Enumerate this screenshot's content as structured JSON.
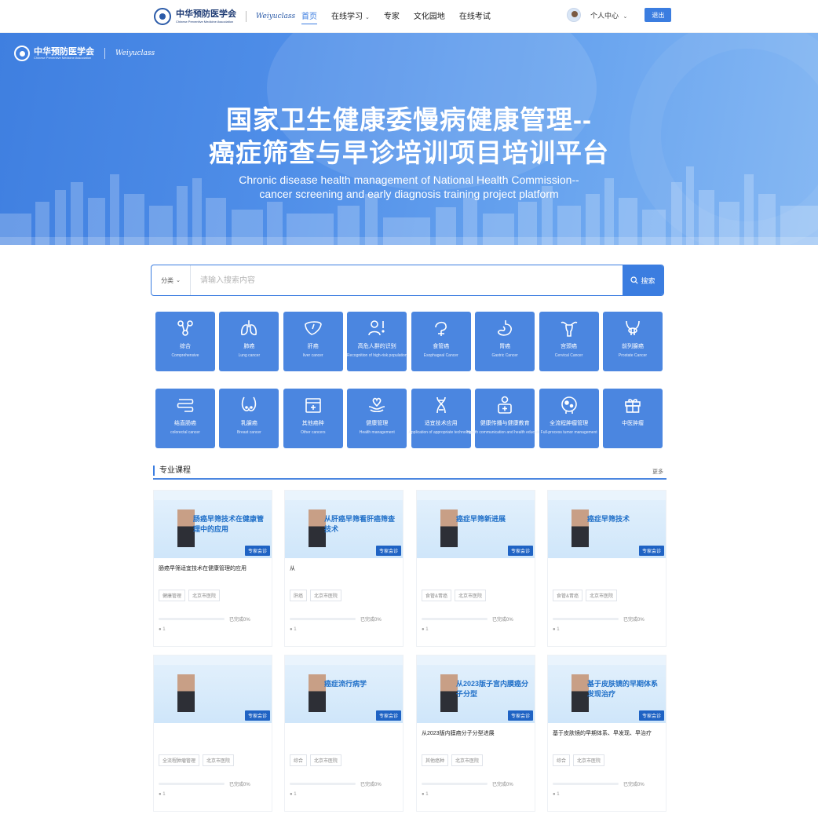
{
  "header": {
    "org_cn": "中华预防医学会",
    "org_en": "Chinese Preventive Medicine Association",
    "partner": "Weiyuclass",
    "nav": [
      {
        "label": "首页",
        "active": true
      },
      {
        "label": "在线学习",
        "dropdown": true
      },
      {
        "label": "专家"
      },
      {
        "label": "文化园地"
      },
      {
        "label": "在线考试"
      }
    ],
    "user_center": "个人中心",
    "logout": "退出"
  },
  "banner": {
    "title_line1": "国家卫生健康委慢病健康管理--",
    "title_line2": "癌症筛查与早诊培训项目培训平台",
    "subtitle_line1": "Chronic disease health management of National Health Commission--",
    "subtitle_line2": "cancer screening and early diagnosis training project platform"
  },
  "search": {
    "category": "分类",
    "placeholder": "请输入搜索内容",
    "button": "搜索"
  },
  "categories_row1": [
    {
      "cn": "综合",
      "en": "Comprehensive",
      "icon": "molecule-icon"
    },
    {
      "cn": "肺癌",
      "en": "Lung cancer",
      "icon": "lung-icon"
    },
    {
      "cn": "肝癌",
      "en": "liver cancer",
      "icon": "liver-icon"
    },
    {
      "cn": "高危人群的识别",
      "en": "Recognition of high-risk population",
      "icon": "alert-person-icon"
    },
    {
      "cn": "食管癌",
      "en": "Esophageal Cancer",
      "icon": "esophagus-icon"
    },
    {
      "cn": "胃癌",
      "en": "Gastric Cancer",
      "icon": "stomach-icon"
    },
    {
      "cn": "宫颈癌",
      "en": "Cervical Cancer",
      "icon": "uterus-icon"
    },
    {
      "cn": "前列腺癌",
      "en": "Prostate Cancer",
      "icon": "prostate-icon"
    }
  ],
  "categories_row2": [
    {
      "cn": "结直肠癌",
      "en": "colorectal cancer",
      "icon": "intestine-icon"
    },
    {
      "cn": "乳腺癌",
      "en": "Breast cancer",
      "icon": "breast-icon"
    },
    {
      "cn": "其他癌种",
      "en": "Other cancers",
      "icon": "medical-kit-icon"
    },
    {
      "cn": "健康管理",
      "en": "Health management",
      "icon": "heart-hand-icon"
    },
    {
      "cn": "适宜技术应用",
      "en": "Application of appropriate technology",
      "icon": "dna-icon"
    },
    {
      "cn": "健康传播与健康教育",
      "en": "Health communication and health education",
      "icon": "person-cross-icon"
    },
    {
      "cn": "全流程肿瘤管理",
      "en": "Full-process tumor management",
      "icon": "cell-icon"
    },
    {
      "cn": "中医肿瘤",
      "en": "",
      "icon": "gift-box-icon"
    }
  ],
  "courses_section": {
    "title": "专业课程",
    "more": "更多"
  },
  "courses": [
    {
      "thumb_text": "肠癌早筛技术在健康管理中的应用",
      "badge": "专家会诊",
      "name": "肠癌早筛适宜技术在健康管理的应用",
      "tags": [
        "健康管理",
        "北京市医院"
      ],
      "progress_label": "已完成0%",
      "progress": 0,
      "views": "1"
    },
    {
      "thumb_text": "从肝癌早筛看肝癌筛查技术",
      "badge": "专家会诊",
      "name": "从",
      "tags": [
        "肝癌",
        "北京市医院"
      ],
      "progress_label": "已完成0%",
      "progress": 0,
      "views": "1"
    },
    {
      "thumb_text": "癌症早筛新进展",
      "badge": "专家会诊",
      "name": "",
      "tags": [
        "食管&胃癌",
        "北京市医院"
      ],
      "progress_label": "已完成0%",
      "progress": 0,
      "views": "1"
    },
    {
      "thumb_text": "癌症早筛技术",
      "badge": "专家会诊",
      "name": "",
      "tags": [
        "食管&胃癌",
        "北京市医院"
      ],
      "progress_label": "已完成0%",
      "progress": 0,
      "views": "1"
    },
    {
      "thumb_text": "",
      "badge": "专家会诊",
      "name": "",
      "tags": [
        "全流程肿瘤管理",
        "北京市医院"
      ],
      "progress_label": "已完成0%",
      "progress": 0,
      "views": "1"
    },
    {
      "thumb_text": "癌症流行病学",
      "badge": "专家会诊",
      "name": "",
      "tags": [
        "综合",
        "北京市医院"
      ],
      "progress_label": "已完成0%",
      "progress": 0,
      "views": "1"
    },
    {
      "thumb_text": "从2023版子宫内膜癌分子分型",
      "badge": "专家会诊",
      "name": "从2023版内膜癌分子分型进展",
      "tags": [
        "其他癌种",
        "北京市医院"
      ],
      "progress_label": "已完成0%",
      "progress": 0,
      "views": "1"
    },
    {
      "thumb_text": "基于皮肤镜的早期体系发现治疗",
      "badge": "专家会诊",
      "name": "基于皮肤镜的早期体系、早发现、早治疗",
      "tags": [
        "综合",
        "北京市医院"
      ],
      "progress_label": "已完成0%",
      "progress": 0,
      "views": "1"
    }
  ],
  "colors": {
    "primary": "#3b7de0",
    "tile": "#4b86e0",
    "banner_start": "#3f7fe0",
    "banner_end": "#86b8f3"
  }
}
